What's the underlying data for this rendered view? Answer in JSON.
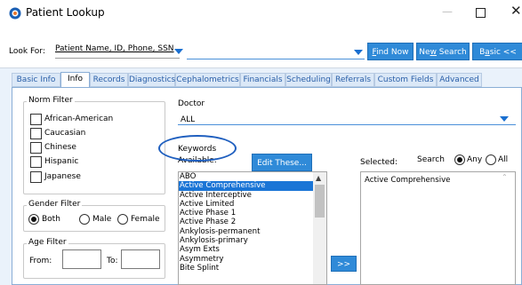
{
  "window": {
    "title": "Patient Lookup",
    "minimize": "—",
    "close": "✕"
  },
  "lookfor": {
    "label_prefix": "Look For: ",
    "field_value": "Patient Name, ID, Phone, SSN",
    "search_value": "",
    "find_now": {
      "prefix": "",
      "key": "F",
      "rest": "ind Now"
    },
    "new_search": {
      "prefix": "Ne",
      "key": "w",
      "rest": " Search"
    },
    "basic": {
      "prefix": "B",
      "key": "a",
      "rest": "sic <<"
    }
  },
  "tabs": [
    "Basic Info",
    "Info",
    "Records",
    "Diagnostics",
    "Cephalometrics",
    "Financials",
    "Scheduling",
    "Referrals",
    "Custom Fields",
    "Advanced"
  ],
  "active_tab": "Info",
  "norm_filter": {
    "title": "Norm Filter",
    "options": [
      "African-American",
      "Caucasian",
      "Chinese",
      "Hispanic",
      "Japanese"
    ]
  },
  "gender_filter": {
    "title": "Gender Filter",
    "options": [
      "Both",
      "Male",
      "Female"
    ],
    "selected": "Both"
  },
  "age_filter": {
    "title": "Age Filter",
    "from_label": "From:",
    "to_label": "To:",
    "from_value": "",
    "to_value": ""
  },
  "doctor": {
    "title": "Doctor",
    "value": "ALL"
  },
  "keywords": {
    "title": "Keywords",
    "available_label": "Available:",
    "edit_button": "Edit These...",
    "items": [
      "ABO",
      "Active Comprehensive",
      "Active Interceptive",
      "Active Limited",
      "Active Phase 1",
      "Active Phase 2",
      "Ankylosis-permanent",
      "Ankylosis-primary",
      "Asym Exts",
      "Asymmetry",
      "Bite Splint"
    ],
    "selected_item": "Active Comprehensive",
    "move_button": ">>",
    "selected_label": "Selected:",
    "search_label": "Search",
    "search_options": [
      "Any",
      "All"
    ],
    "search_selected": "Any",
    "selected_items": [
      "Active Comprehensive"
    ]
  },
  "colors": {
    "accent": "#2f8ad8",
    "selection": "#1a75d6",
    "annotation": "#1f5fbf"
  }
}
